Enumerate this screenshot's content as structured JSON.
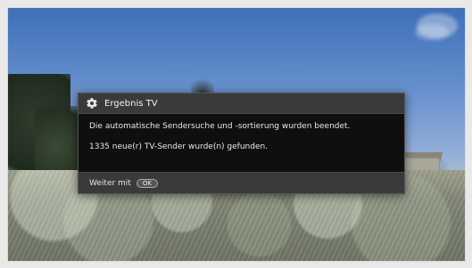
{
  "dialog": {
    "title": "Ergebnis TV",
    "message_line_1": "Die automatische Sendersuche und -sortierung wurden beendet.",
    "message_line_2": "1335 neue(r) TV-Sender wurde(n) gefunden.",
    "footer_label": "Weiter mit",
    "footer_button_label": "OK",
    "icons": {
      "title_icon": "gear-icon"
    }
  },
  "colors": {
    "dialog_background": "#1d1d1d",
    "dialog_header": "#3a3a3a",
    "dialog_body": "#0f0f0f",
    "text": "#e8e8e8"
  }
}
